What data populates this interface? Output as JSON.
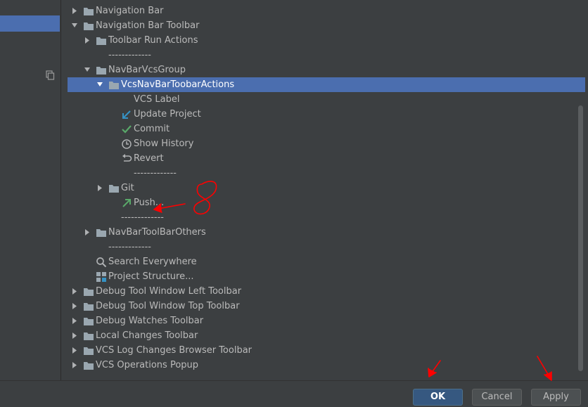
{
  "tree": {
    "rows": [
      {
        "label": "Navigation Bar",
        "depth": 0,
        "expander": "collapsed",
        "icon": "folder-icon"
      },
      {
        "label": "Navigation Bar Toolbar",
        "depth": 0,
        "expander": "expanded",
        "icon": "folder-icon"
      },
      {
        "label": "Toolbar Run Actions",
        "depth": 1,
        "expander": "collapsed",
        "icon": "folder-icon"
      },
      {
        "label": "-------------",
        "depth": 1,
        "expander": "none",
        "icon": "none"
      },
      {
        "label": "NavBarVcsGroup",
        "depth": 1,
        "expander": "expanded",
        "icon": "folder-icon"
      },
      {
        "label": "VcsNavBarToobarActions",
        "depth": 2,
        "expander": "expanded",
        "icon": "folder-icon",
        "selected": true
      },
      {
        "label": "VCS Label",
        "depth": 3,
        "expander": "none",
        "icon": "none"
      },
      {
        "label": "Update Project",
        "depth": 3,
        "expander": "none",
        "icon": "update-arrow-icon"
      },
      {
        "label": "Commit",
        "depth": 3,
        "expander": "none",
        "icon": "checkmark-icon"
      },
      {
        "label": "Show History",
        "depth": 3,
        "expander": "none",
        "icon": "clock-icon"
      },
      {
        "label": "Revert",
        "depth": 3,
        "expander": "none",
        "icon": "revert-icon"
      },
      {
        "label": "-------------",
        "depth": 3,
        "expander": "none",
        "icon": "none"
      },
      {
        "label": "Git",
        "depth": 2,
        "expander": "collapsed",
        "icon": "folder-icon"
      },
      {
        "label": "Push...",
        "depth": 3,
        "expander": "none",
        "icon": "push-arrow-icon"
      },
      {
        "label": "-------------",
        "depth": 2,
        "expander": "none",
        "icon": "none"
      },
      {
        "label": "NavBarToolBarOthers",
        "depth": 1,
        "expander": "collapsed",
        "icon": "folder-icon"
      },
      {
        "label": "-------------",
        "depth": 1,
        "expander": "none",
        "icon": "none"
      },
      {
        "label": "Search Everywhere",
        "depth": 1,
        "expander": "none",
        "icon": "search-icon"
      },
      {
        "label": "Project Structure...",
        "depth": 1,
        "expander": "none",
        "icon": "project-structure-icon"
      },
      {
        "label": "Debug Tool Window Left Toolbar",
        "depth": 0,
        "expander": "collapsed",
        "icon": "folder-icon"
      },
      {
        "label": "Debug Tool Window Top Toolbar",
        "depth": 0,
        "expander": "collapsed",
        "icon": "folder-icon"
      },
      {
        "label": "Debug Watches Toolbar",
        "depth": 0,
        "expander": "collapsed",
        "icon": "folder-icon"
      },
      {
        "label": "Local Changes Toolbar",
        "depth": 0,
        "expander": "collapsed",
        "icon": "folder-icon"
      },
      {
        "label": "VCS Log Changes Browser Toolbar",
        "depth": 0,
        "expander": "collapsed",
        "icon": "folder-icon"
      },
      {
        "label": "VCS Operations Popup",
        "depth": 0,
        "expander": "collapsed",
        "icon": "folder-icon"
      }
    ]
  },
  "buttons": {
    "ok_label": "OK",
    "cancel_label": "Cancel",
    "apply_label": "Apply"
  },
  "colors": {
    "background": "#3c3f41",
    "selection": "#4b6eaf",
    "folder": "#9aa7b0",
    "annotation": "#ff0000"
  }
}
